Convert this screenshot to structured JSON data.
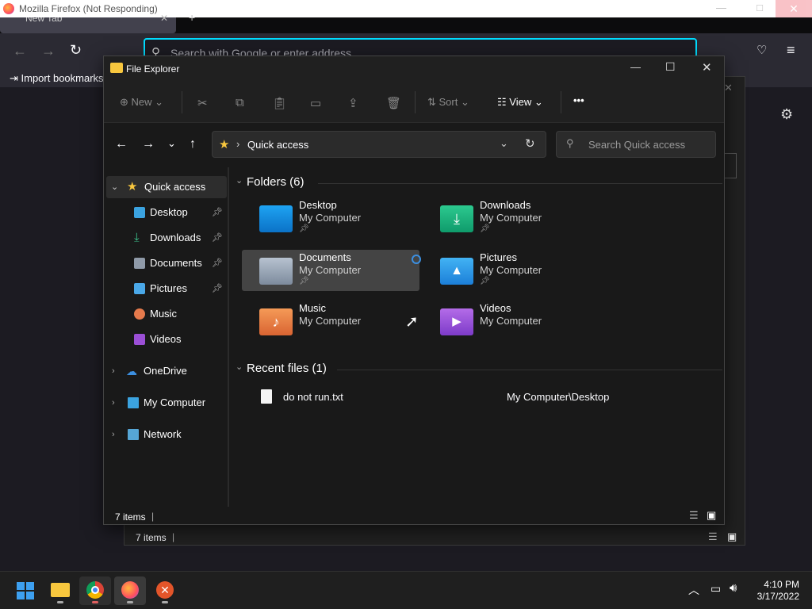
{
  "firefox": {
    "window_title": "Mozilla Firefox (Not Responding)",
    "tab_title": "New Tab",
    "address_placeholder": "Search with Google or enter address",
    "bookmark_import": "Import bookmarks..."
  },
  "explorer": {
    "title": "File Explorer",
    "cmd": {
      "new": "New",
      "sort": "Sort",
      "view": "View",
      "more": "•••"
    },
    "address": "Quick access",
    "search_placeholder": "Search Quick access",
    "nav": {
      "quick_access": "Quick access",
      "desktop": "Desktop",
      "downloads": "Downloads",
      "documents": "Documents",
      "pictures": "Pictures",
      "music": "Music",
      "videos": "Videos",
      "onedrive": "OneDrive",
      "my_computer": "My Computer",
      "network": "Network"
    },
    "folders_header": "Folders (6)",
    "folders": [
      {
        "name": "Desktop",
        "location": "My Computer"
      },
      {
        "name": "Downloads",
        "location": "My Computer"
      },
      {
        "name": "Documents",
        "location": "My Computer"
      },
      {
        "name": "Pictures",
        "location": "My Computer"
      },
      {
        "name": "Music",
        "location": "My Computer"
      },
      {
        "name": "Videos",
        "location": "My Computer"
      }
    ],
    "recent_header": "Recent files (1)",
    "recent": [
      {
        "name": "do not run.txt",
        "path": "My Computer\\Desktop"
      }
    ],
    "status": "7 items",
    "back_window_status": "7 items"
  },
  "taskbar": {
    "time": "4:10 PM",
    "date": "3/17/2022"
  },
  "colors": {
    "accent": "#0078d4",
    "firefox_focus": "#00ddff",
    "taskbar": "#1f1f1f"
  }
}
